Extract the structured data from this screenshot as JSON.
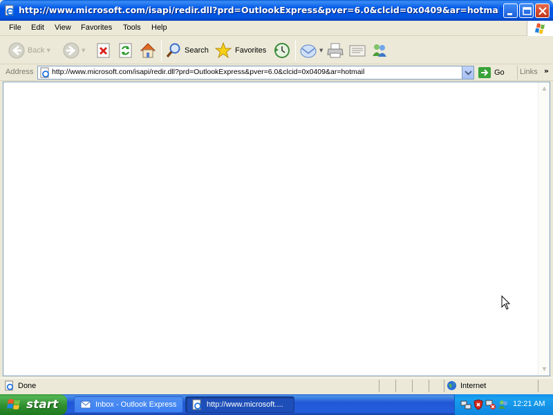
{
  "window": {
    "title": "http://www.microsoft.com/isapi/redir.dll?prd=OutlookExpress&pver=6.0&clcid=0x0409&ar=hotmail - Microso..."
  },
  "menu": [
    "File",
    "Edit",
    "View",
    "Favorites",
    "Tools",
    "Help"
  ],
  "toolbar": {
    "back": "Back",
    "search": "Search",
    "favorites": "Favorites"
  },
  "address": {
    "label": "Address",
    "url": "http://www.microsoft.com/isapi/redir.dll?prd=OutlookExpress&pver=6.0&clcid=0x0409&ar=hotmail",
    "go": "Go",
    "links": "Links"
  },
  "status": {
    "text": "Done",
    "zone": "Internet"
  },
  "taskbar": {
    "start": "start",
    "tasks": [
      {
        "label": "Inbox - Outlook Express"
      },
      {
        "label": "http://www.microsoft...."
      }
    ],
    "clock": "12:21 AM"
  },
  "colors": {
    "titlebar": "#0058e6",
    "chrome": "#ece9d8",
    "taskbar": "#245edb",
    "start": "#2f8f2f"
  }
}
